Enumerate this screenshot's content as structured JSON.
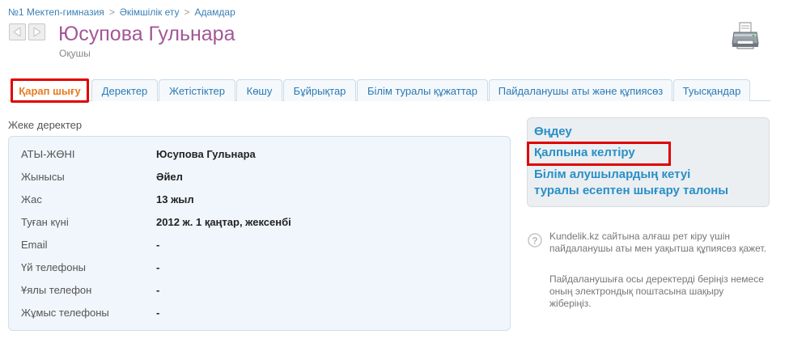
{
  "breadcrumb": {
    "items": [
      "№1 Мектеп-гимназия",
      "Әкімшілік ету",
      "Адамдар"
    ],
    "separator": ">"
  },
  "header": {
    "title": "Юсупова Гульнара",
    "subtitle": "Оқушы"
  },
  "tabs": [
    {
      "label": "Қарап шығу",
      "active": true
    },
    {
      "label": "Деректер",
      "active": false
    },
    {
      "label": "Жетістіктер",
      "active": false
    },
    {
      "label": "Көшу",
      "active": false
    },
    {
      "label": "Бұйрықтар",
      "active": false
    },
    {
      "label": "Білім туралы құжаттар",
      "active": false
    },
    {
      "label": "Пайдаланушы аты және құпиясөз",
      "active": false
    },
    {
      "label": "Туысқандар",
      "active": false
    }
  ],
  "personal": {
    "section_title": "Жеке деректер",
    "rows": [
      {
        "label": "АТЫ-ЖӨНІ",
        "value": "Юсупова Гульнара"
      },
      {
        "label": "Жынысы",
        "value": "Әйел"
      },
      {
        "label": "Жас",
        "value": "13 жыл"
      },
      {
        "label": "Туған күні",
        "value": "2012 ж. 1 қаңтар, жексенбі"
      },
      {
        "label": "Email",
        "value": "-"
      },
      {
        "label": "Үй телефоны",
        "value": "-"
      },
      {
        "label": "Ұялы телефон",
        "value": "-"
      },
      {
        "label": "Жұмыс телефоны",
        "value": "-"
      }
    ]
  },
  "actions": {
    "edit": "Өңдеу",
    "restore": "Қалпына келтіру",
    "deregister_line1": "Білім алушылардың кетуі",
    "deregister_line2": "туралы есептен шығару талоны"
  },
  "help": {
    "paragraph1": "Kundelik.kz сайтына алғаш рет кіру үшін пайдаланушы аты мен уақытша құпиясөз қажет.",
    "paragraph2": "Пайдаланушыға осы деректерді беріңіз немесе оның электрондық поштасына шақыру жіберіңіз."
  },
  "colors": {
    "title": "#a25896",
    "link": "#2a8fc7",
    "active_tab_text": "#e87b1e",
    "highlight_border": "#e00000"
  },
  "icons": [
    "arrow-left-icon",
    "arrow-right-icon",
    "printer-icon",
    "help-icon"
  ]
}
